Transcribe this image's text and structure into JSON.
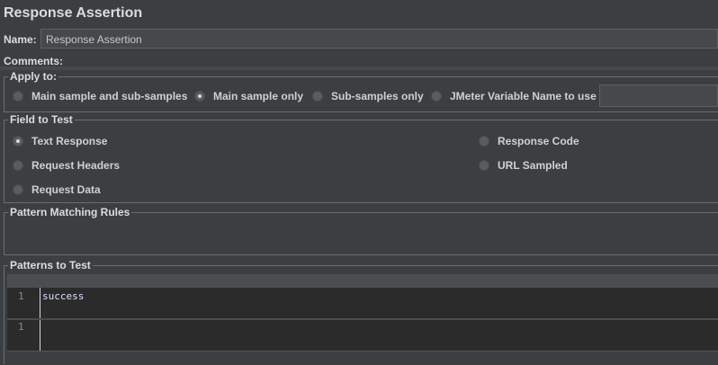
{
  "title": "Response Assertion",
  "name": {
    "label": "Name:",
    "value": "Response Assertion"
  },
  "comments": {
    "label": "Comments:"
  },
  "apply_to": {
    "legend": "Apply to:",
    "options": [
      {
        "label": "Main sample and sub-samples",
        "selected": false
      },
      {
        "label": "Main sample only",
        "selected": true
      },
      {
        "label": "Sub-samples only",
        "selected": false
      },
      {
        "label": "JMeter Variable Name to use",
        "selected": false
      }
    ],
    "variable_value": ""
  },
  "field_to_test": {
    "legend": "Field to Test",
    "options": [
      {
        "label": "Text Response",
        "selected": true
      },
      {
        "label": "Request Headers",
        "selected": false
      },
      {
        "label": "Request Data",
        "selected": false
      },
      {
        "label": "Response Code",
        "selected": false
      },
      {
        "label": "URL Sampled",
        "selected": false
      }
    ]
  },
  "pattern_matching": {
    "legend": "Pattern Matching Rules"
  },
  "patterns": {
    "legend": "Patterns to Test",
    "editors": [
      {
        "line_number": "1",
        "text": "success"
      },
      {
        "line_number": "1",
        "text": ""
      }
    ]
  },
  "colors": {
    "background": "#3c3f41",
    "editor": "#2b2b2b",
    "text": "#d6d6d6"
  }
}
